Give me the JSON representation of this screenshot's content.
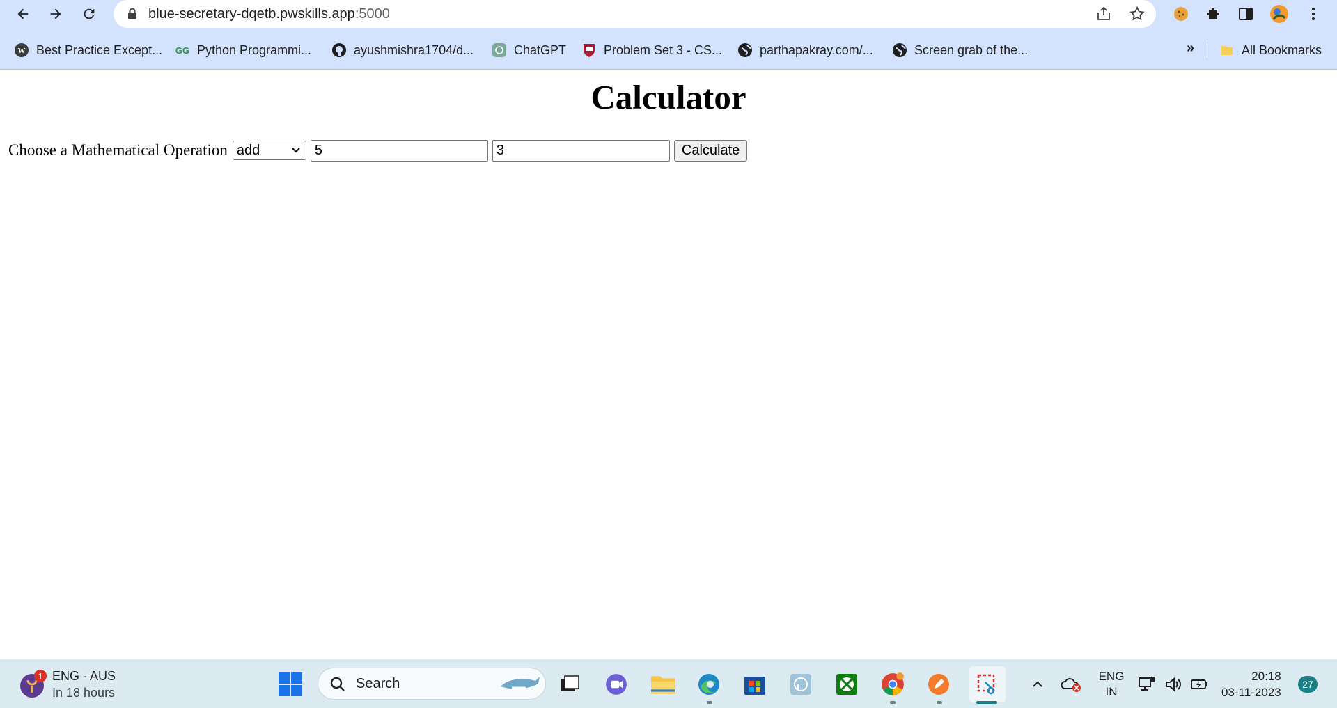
{
  "browser": {
    "url_host": "blue-secretary-dqetb.pwskills.app",
    "url_port": ":5000",
    "bookmarks": [
      {
        "label": "Best Practice Except...",
        "icon": "wordpress-icon"
      },
      {
        "label": "Python Programmi...",
        "icon": "geeksforgeeks-icon"
      },
      {
        "label": "ayushmishra1704/d...",
        "icon": "github-icon"
      },
      {
        "label": "ChatGPT",
        "icon": "chatgpt-icon"
      },
      {
        "label": "Problem Set 3 - CS...",
        "icon": "harvard-icon"
      },
      {
        "label": "parthapakray.com/...",
        "icon": "globe-icon"
      },
      {
        "label": "Screen grab of the...",
        "icon": "globe-icon"
      }
    ],
    "more_bookmarks": "»",
    "all_bookmarks_label": "All Bookmarks"
  },
  "page": {
    "title": "Calculator",
    "operation_label": "Choose a Mathematical Operation",
    "operation_selected": "add",
    "input1_value": "5",
    "input2_value": "3",
    "calculate_label": "Calculate"
  },
  "taskbar": {
    "weather_badge": "1",
    "weather_line1": "ENG - AUS",
    "weather_line2": "In 18 hours",
    "search_placeholder": "Search",
    "lang_line1": "ENG",
    "lang_line2": "IN",
    "time": "20:18",
    "date": "03-11-2023",
    "notification_count": "27"
  }
}
